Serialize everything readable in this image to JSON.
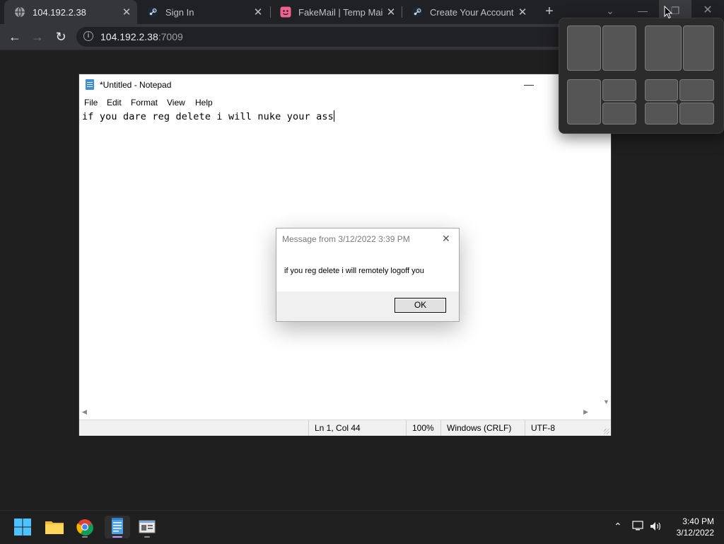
{
  "browser": {
    "tabs": [
      {
        "title": "104.192.2.38",
        "active": true,
        "icon": "globe-icon"
      },
      {
        "title": "Sign In",
        "active": false,
        "icon": "steam-icon"
      },
      {
        "title": "FakeMail | Temp Mail A",
        "active": false,
        "icon": "fakemail-icon"
      },
      {
        "title": "Create Your Account",
        "active": false,
        "icon": "steam-icon"
      }
    ],
    "new_tab": "+",
    "url_host": "104.192.2.38",
    "url_port": ":7009"
  },
  "notepad": {
    "title": "*Untitled - Notepad",
    "menu": [
      "File",
      "Edit",
      "Format",
      "View",
      "Help"
    ],
    "text": "if you dare reg delete i will nuke your ass",
    "status": {
      "position": "Ln 1, Col 44",
      "zoom": "100%",
      "line_ending": "Windows (CRLF)",
      "encoding": "UTF-8"
    }
  },
  "message": {
    "title": "Message from  3/12/2022 3:39 PM",
    "body": "if you reg delete i will remotely logoff you",
    "ok": "OK"
  },
  "taskbar": {
    "clock_time": "3:40 PM",
    "clock_date": "3/12/2022",
    "apps": [
      "start-icon",
      "file-explorer-icon",
      "chrome-icon",
      "notepad-icon",
      "remote-app-icon"
    ]
  },
  "colors": {
    "tab_active": "#35363a",
    "snap_zone": "#555555",
    "taskbar_accent": "#c49bff"
  }
}
